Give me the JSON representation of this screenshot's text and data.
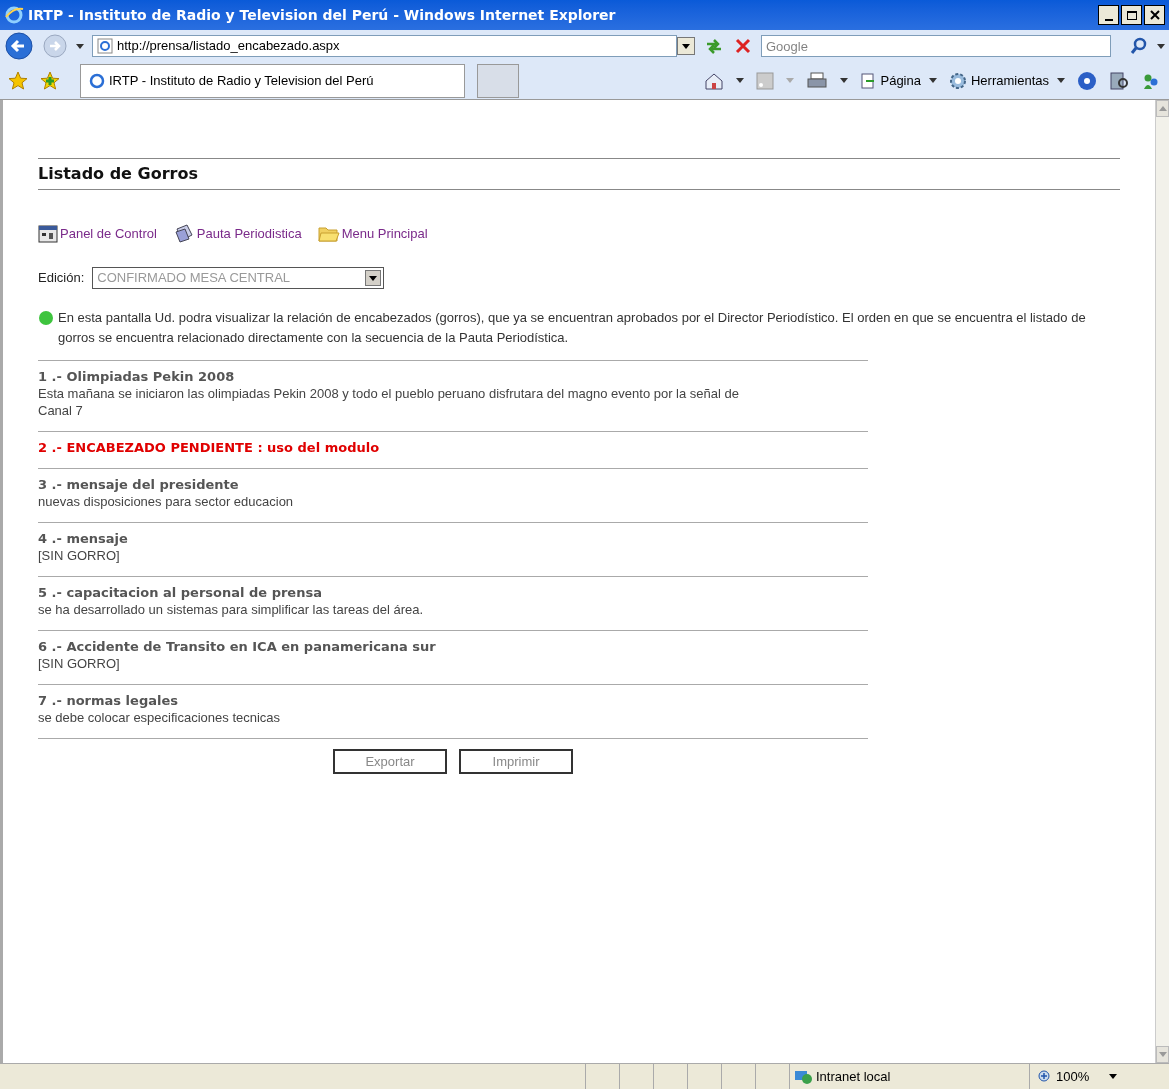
{
  "window": {
    "title": "IRTP - Instituto de Radio y Television del Perú - Windows Internet Explorer"
  },
  "address_bar": {
    "url": "http://prensa/listado_encabezado.aspx"
  },
  "search": {
    "placeholder": "Google"
  },
  "tabs": [
    {
      "label": "IRTP - Instituto de Radio y Television del Perú",
      "selected": true
    }
  ],
  "command_bar": [
    "Página",
    "Herramientas"
  ],
  "page": {
    "title": "Listado de Gorros",
    "links": [
      {
        "kind": "panel",
        "label": "Panel de Control"
      },
      {
        "kind": "pauta",
        "label": "Pauta Periodistica"
      },
      {
        "kind": "folder",
        "label": "Menu Principal"
      }
    ],
    "edition": {
      "label": "Edición:",
      "value": "CONFIRMADO MESA CENTRAL",
      "disabled": true
    },
    "info": "En esta pantalla Ud. podra visualizar la relación de encabezados (gorros), que ya se encuentran aprobados por el Director Periodístico. El orden en que se encuentra el listado de gorros se encuentra relacionado directamente con la secuencia de la Pauta Periodística.",
    "items": [
      {
        "heading": "1 .- Olimpiadas Pekin 2008",
        "pending": false,
        "body": "Esta mañana se iniciaron las olimpiadas Pekin 2008 y todo el pueblo peruano disfrutara del magno evento por la señal de Canal 7"
      },
      {
        "heading": "2 .- ENCABEZADO PENDIENTE : uso del modulo",
        "pending": true
      },
      {
        "heading": "3 .- mensaje del presidente",
        "pending": false,
        "body": "nuevas disposiciones para sector educacion"
      },
      {
        "heading": "4 .- mensaje",
        "pending": false,
        "body": "[SIN GORRO]"
      },
      {
        "heading": "5 .- capacitacion al personal de prensa",
        "pending": false,
        "body": "se ha desarrollado un sistemas para simplificar las tareas del área."
      },
      {
        "heading": "6 .- Accidente de Transito en ICA en panamericana sur",
        "pending": false,
        "body": "[SIN GORRO]"
      },
      {
        "heading": "7 .- normas legales",
        "pending": false,
        "body": "se debe colocar especificaciones tecnicas"
      }
    ],
    "buttons": [
      "Exportar",
      "Imprimir"
    ]
  },
  "status_bar": {
    "zone": "Intranet local",
    "zoom": "100%"
  }
}
